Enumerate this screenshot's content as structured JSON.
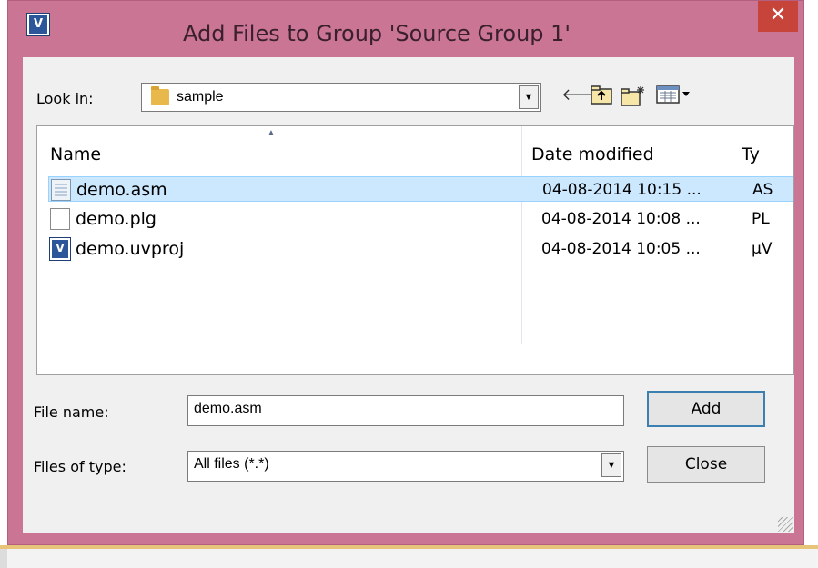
{
  "window": {
    "title": "Add Files to Group 'Source Group 1'",
    "app_icon": "uv4-icon",
    "close_glyph": "✕"
  },
  "lookin": {
    "label": "Look in:",
    "value": "sample"
  },
  "toolbar": {
    "icons": [
      "back-arrow-icon",
      "up-folder-icon",
      "new-folder-icon",
      "view-menu-icon"
    ]
  },
  "filelist": {
    "columns": [
      "Name",
      "Date modified",
      "Ty"
    ],
    "rows": [
      {
        "name": "demo.asm",
        "date": "04-08-2014 10:15 ...",
        "type": "AS",
        "icon": "asm-file-icon",
        "selected": true
      },
      {
        "name": "demo.plg",
        "date": "04-08-2014 10:08 ...",
        "type": "PL",
        "icon": "plg-file-icon",
        "selected": false
      },
      {
        "name": "demo.uvproj",
        "date": "04-08-2014 10:05 ...",
        "type": "µV",
        "icon": "uvproj-file-icon",
        "selected": false
      }
    ],
    "scroll": {
      "left": "<",
      "right": ">"
    }
  },
  "filename": {
    "label": "File name:",
    "value": "demo.asm"
  },
  "filetype": {
    "label": "Files of type:",
    "value": "All files (*.*)"
  },
  "buttons": {
    "add": "Add",
    "close": "Close"
  },
  "colors": {
    "frame": "#c97593",
    "close_button": "#c7443b",
    "selection": "#cce8ff"
  }
}
